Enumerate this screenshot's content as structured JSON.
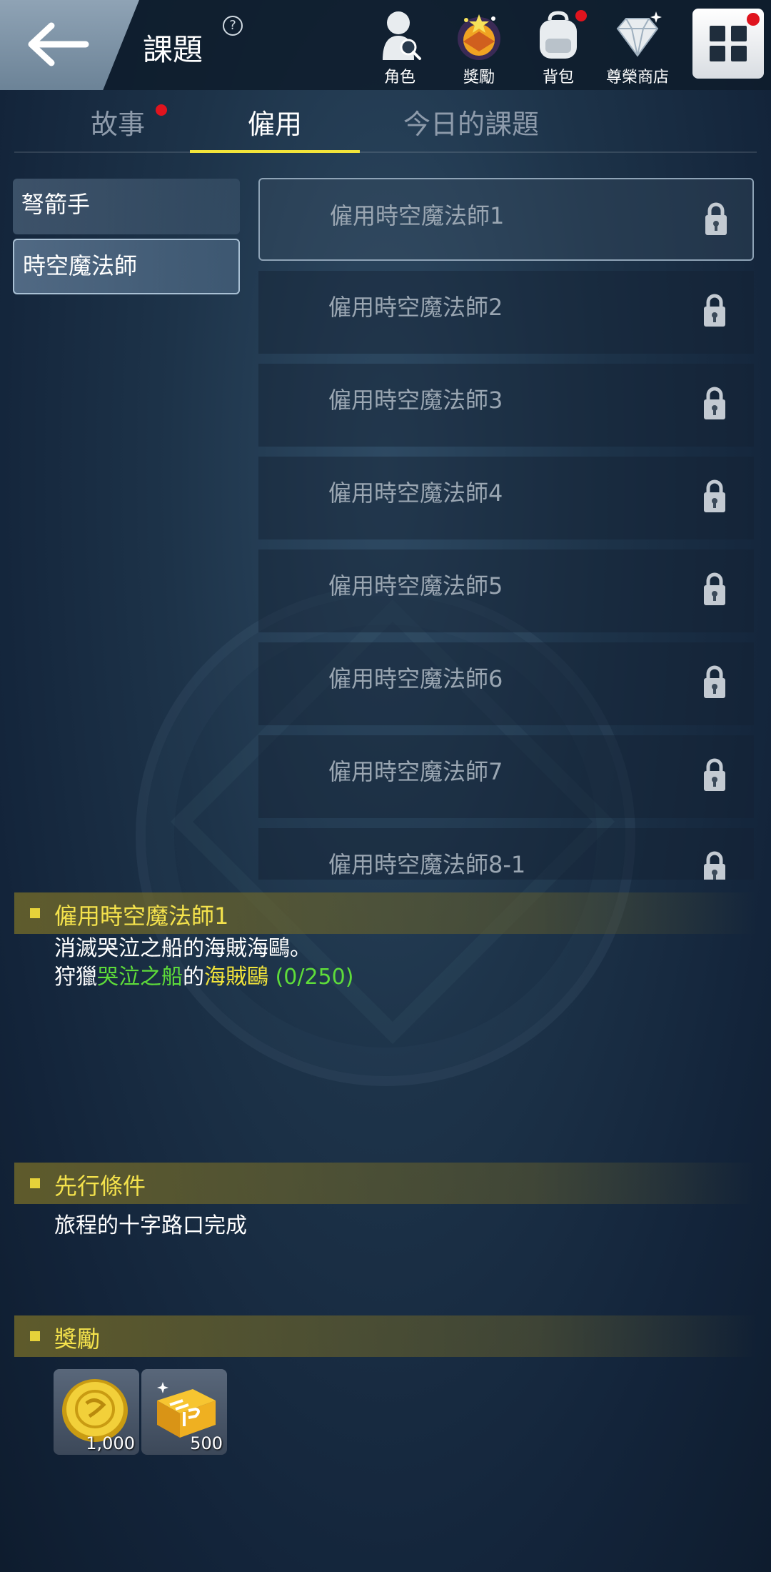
{
  "header": {
    "title": "課題",
    "help_icon": "?",
    "nav": [
      {
        "label": "角色",
        "icon": "character-search-icon",
        "badge": false
      },
      {
        "label": "獎勵",
        "icon": "reward-icon",
        "badge": false
      },
      {
        "label": "背包",
        "icon": "backpack-icon",
        "badge": true
      },
      {
        "label": "尊榮商店",
        "icon": "diamond-icon",
        "badge": false
      }
    ],
    "menu_badge": true
  },
  "tabs": [
    {
      "label": "故事",
      "active": false,
      "badge": true
    },
    {
      "label": "僱用",
      "active": true,
      "badge": false
    },
    {
      "label": "今日的課題",
      "active": false,
      "badge": false
    }
  ],
  "sidebar": {
    "items": [
      {
        "label": "弩箭手",
        "selected": false
      },
      {
        "label": "時空魔法師",
        "selected": true
      }
    ]
  },
  "quests": [
    {
      "label": "僱用時空魔法師1",
      "locked": true,
      "selected": true
    },
    {
      "label": "僱用時空魔法師2",
      "locked": true,
      "selected": false
    },
    {
      "label": "僱用時空魔法師3",
      "locked": true,
      "selected": false
    },
    {
      "label": "僱用時空魔法師4",
      "locked": true,
      "selected": false
    },
    {
      "label": "僱用時空魔法師5",
      "locked": true,
      "selected": false
    },
    {
      "label": "僱用時空魔法師6",
      "locked": true,
      "selected": false
    },
    {
      "label": "僱用時空魔法師7",
      "locked": true,
      "selected": false
    },
    {
      "label": "僱用時空魔法師8-1",
      "locked": true,
      "selected": false
    }
  ],
  "detail": {
    "title": "僱用時空魔法師1",
    "description": "消滅哭泣之船的海賊海鷗。",
    "objective_prefix": "狩獵",
    "objective_location": "哭泣之船",
    "objective_joiner": "的",
    "objective_target": "海賊鷗",
    "objective_progress": "(0/250)"
  },
  "prerequisite": {
    "title": "先行條件",
    "text": "旅程的十字路口完成"
  },
  "rewards": {
    "title": "獎勵",
    "items": [
      {
        "icon": "gold-coin-icon",
        "amount": "1,000"
      },
      {
        "icon": "exp-ticket-icon",
        "amount": "500"
      }
    ]
  },
  "colors": {
    "accent_yellow": "#f2e43a",
    "progress_green": "#5edc3a",
    "badge_red": "#e0141e"
  }
}
